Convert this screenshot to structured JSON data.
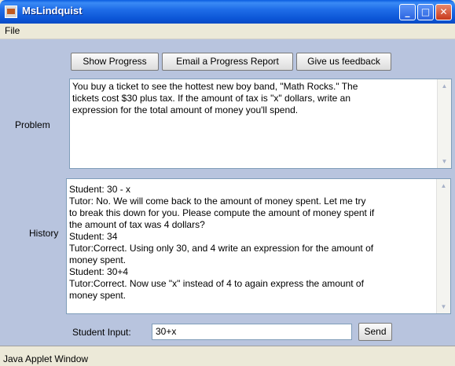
{
  "window": {
    "title": "MsLindquist",
    "minimize_glyph": "_",
    "maximize_glyph": "□",
    "close_glyph": "✕"
  },
  "menu": {
    "file": "File"
  },
  "toolbar": {
    "show_progress": "Show Progress",
    "email_report": "Email a Progress Report",
    "feedback": "Give us feedback"
  },
  "problem": {
    "label": "Problem",
    "lines": [
      "You buy a ticket to see the hottest new boy band, \"Math Rocks.\"  The",
      "tickets cost $30 plus tax.  If the amount of tax is \"x\" dollars, write an",
      "expression for the total amount of money you'll spend."
    ]
  },
  "history": {
    "label": "History",
    "lines": [
      "Student: 30 - x",
      "Tutor: No.  We will come back to the amount of money spent.  Let me try",
      "to break this down for you. Please compute the amount of money spent if",
      "the amount of tax was 4 dollars?",
      "Student: 34",
      "Tutor:Correct. Using only 30, and 4 write an expression for the amount of",
      "money spent.",
      "Student: 30+4",
      "Tutor:Correct. Now use \"x\" instead of 4 to again express the amount of",
      "money spent."
    ]
  },
  "input": {
    "label": "Student Input:",
    "value": "30+x",
    "send": "Send"
  },
  "status": {
    "text": "Java Applet Window"
  },
  "scroll": {
    "up_glyph": "▲",
    "down_glyph": "▼"
  }
}
